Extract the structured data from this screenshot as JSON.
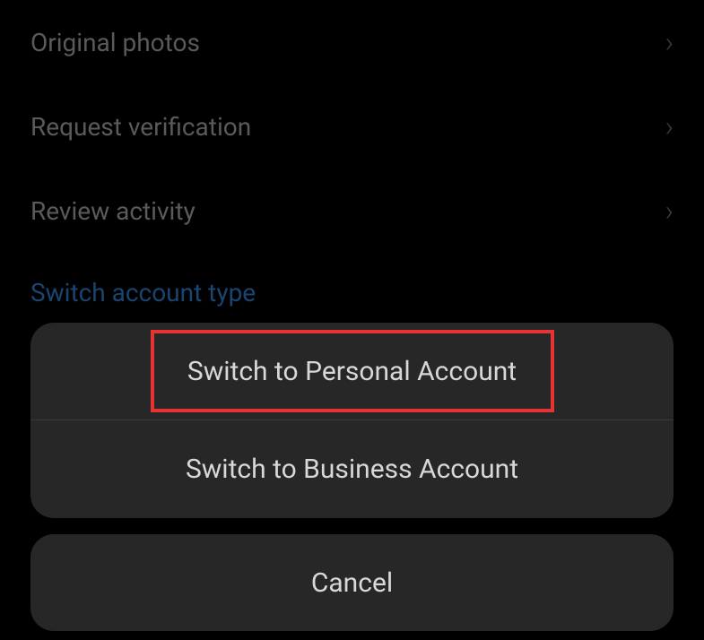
{
  "settings": {
    "items": [
      {
        "label": "Original photos",
        "hasChevron": true
      },
      {
        "label": "Request verification",
        "hasChevron": true
      },
      {
        "label": "Review activity",
        "hasChevron": true
      },
      {
        "label": "Switch account type",
        "hasChevron": false,
        "isLink": true
      }
    ]
  },
  "actionSheet": {
    "options": [
      {
        "label": "Switch to Personal Account",
        "highlighted": true
      },
      {
        "label": "Switch to Business Account",
        "highlighted": false
      }
    ],
    "cancel": "Cancel"
  }
}
